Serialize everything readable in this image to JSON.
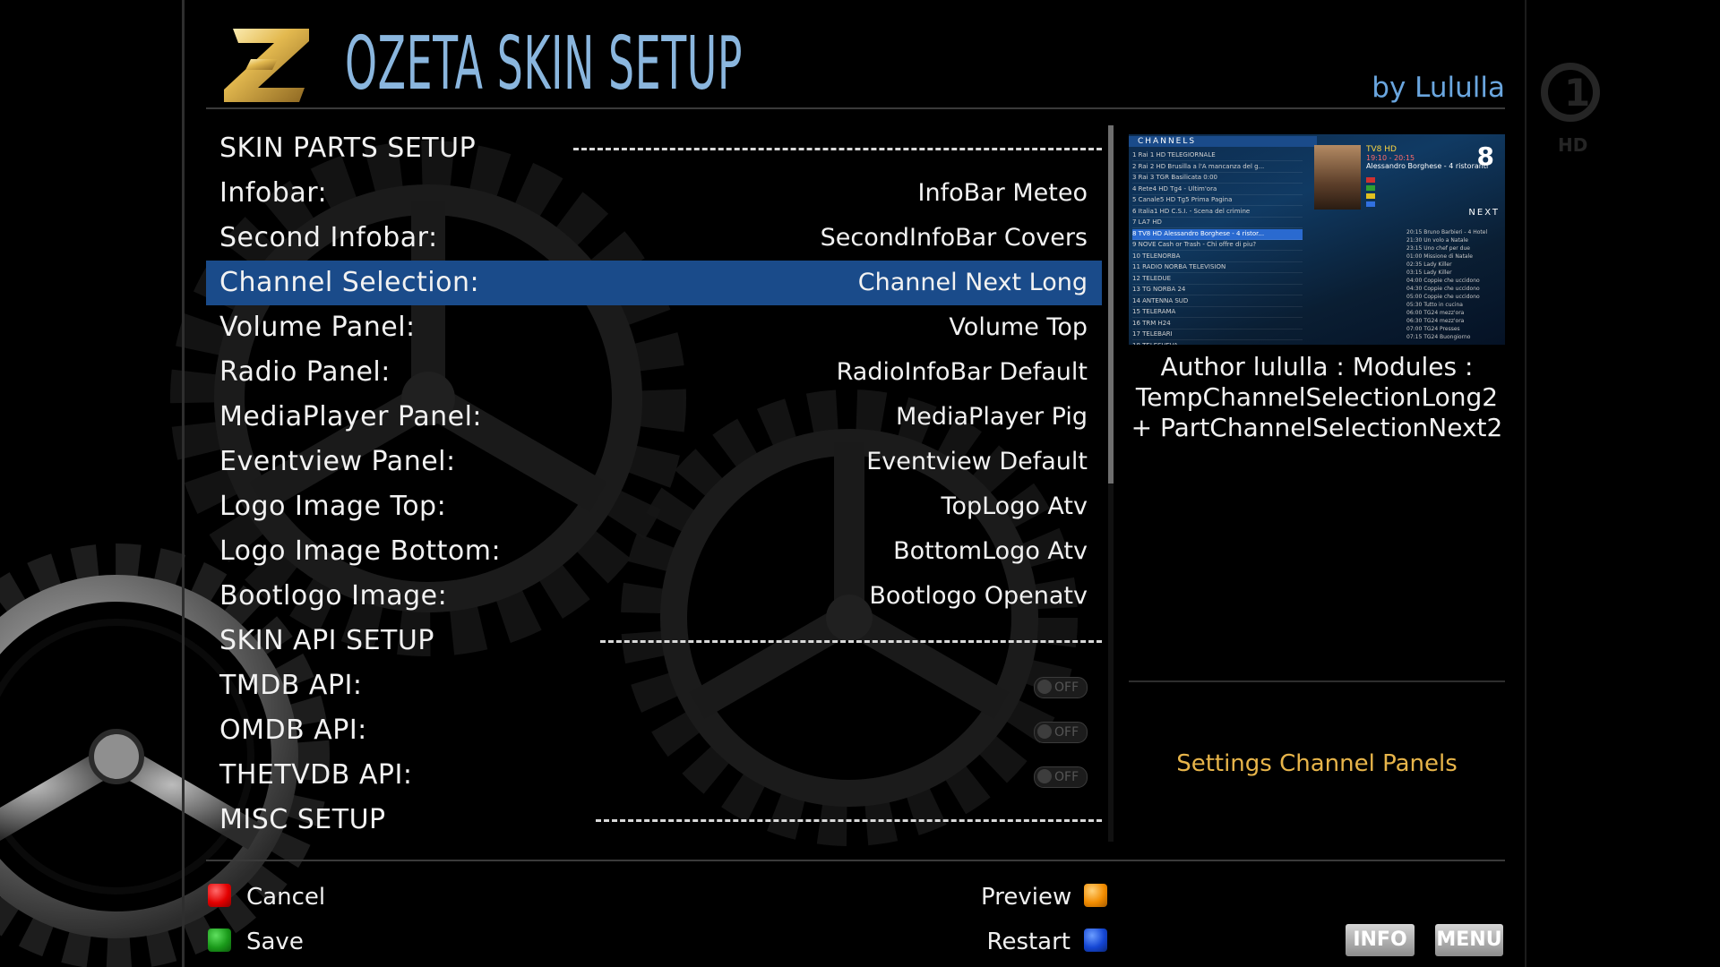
{
  "header": {
    "title": "OZETA SKIN SETUP",
    "byline": "by Lululla"
  },
  "menu": {
    "rows": [
      {
        "label": "SKIN PARTS SETUP",
        "type": "section"
      },
      {
        "label": "Infobar:",
        "value": "InfoBar Meteo",
        "type": "option"
      },
      {
        "label": "Second Infobar:",
        "value": "SecondInfoBar Covers",
        "type": "option"
      },
      {
        "label": "Channel Selection:",
        "value": "Channel Next Long",
        "type": "option",
        "selected": true
      },
      {
        "label": "Volume Panel:",
        "value": "Volume Top",
        "type": "option"
      },
      {
        "label": "Radio Panel:",
        "value": "RadioInfoBar Default",
        "type": "option"
      },
      {
        "label": "MediaPlayer Panel:",
        "value": "MediaPlayer Pig",
        "type": "option"
      },
      {
        "label": "Eventview Panel:",
        "value": "Eventview Default",
        "type": "option"
      },
      {
        "label": "Logo Image Top:",
        "value": "TopLogo Atv",
        "type": "option"
      },
      {
        "label": "Logo Image Bottom:",
        "value": "BottomLogo Atv",
        "type": "option"
      },
      {
        "label": "Bootlogo Image:",
        "value": "Bootlogo Openatv",
        "type": "option"
      },
      {
        "label": "SKIN API SETUP",
        "type": "section"
      },
      {
        "label": "TMDB API:",
        "value": "OFF",
        "type": "toggle"
      },
      {
        "label": "OMDB API:",
        "value": "OFF",
        "type": "toggle"
      },
      {
        "label": "THETVDB API:",
        "value": "OFF",
        "type": "toggle"
      },
      {
        "label": "MISC SETUP",
        "type": "section"
      }
    ]
  },
  "preview": {
    "header_label": "CHANNELS",
    "channel_number": "8",
    "next_label": "NEXT",
    "channel_name": "TV8 HD",
    "time_text": "19:10 - 20:15",
    "program_text": "Alessandro Borghese - 4 ristoranti",
    "channels": [
      "1  Rai 1 HD TELEGIORNALE",
      "2  Rai 2 HD Brusilla a l'A mancanza del g...",
      "3  Rai 3 TGR Basilicata 0:00",
      "4  Rete4 HD Tg4 - Ultim'ora",
      "5  Canale5 HD Tg5 Prima Pagina",
      "6  Italia1 HD C.S.I. - Scena del crimine",
      "7  LA7 HD",
      "8  TV8 HD Alessandro Borghese - 4 ristor...",
      "9  NOVE Cash or Trash - Chi offre di piu?",
      "10 TELENORBA",
      "11 RADIO NORBA TELEVISION",
      "12 TELEDUE",
      "13 TG NORBA 24",
      "14 ANTENNA SUD",
      "15 TELERAMA",
      "16 TRM H24",
      "17 TELEBARI",
      "18 TELESVEVA"
    ],
    "epg_lines": [
      "20:15 Bruno Barbieri - 4 Hotel",
      "21:30 Un volo a Natale",
      "23:15 Uno chef per due",
      "01:00 Missione di Natale",
      "02:35 Lady Killer",
      "03:15 Lady Killer",
      "04:00 Coppie che uccidono",
      "04:30 Coppie che uccidono",
      "05:00 Coppie che uccidono",
      "05:30 Tutto in cucina",
      "06:00 TG24 mezz'ora",
      "06:30 TG24 mezz'ora",
      "07:00 TG24 Presses",
      "07:15 TG24 Buongiorno",
      "07:30 TG24 Buongiorno"
    ]
  },
  "description": {
    "line1": "Author lululla : Modules :",
    "line2": "TempChannelSelectionLong2",
    "line3": "+ PartChannelSelectionNext2",
    "subtitle": "Settings Channel Panels"
  },
  "footer": {
    "cancel": "Cancel",
    "save": "Save",
    "preview": "Preview",
    "restart": "Restart",
    "info": "INFO",
    "menu": "MENU"
  },
  "colors": {
    "title": "#8ab6de",
    "selection": "#1a4b8a",
    "subtitle": "#e8b54a"
  }
}
